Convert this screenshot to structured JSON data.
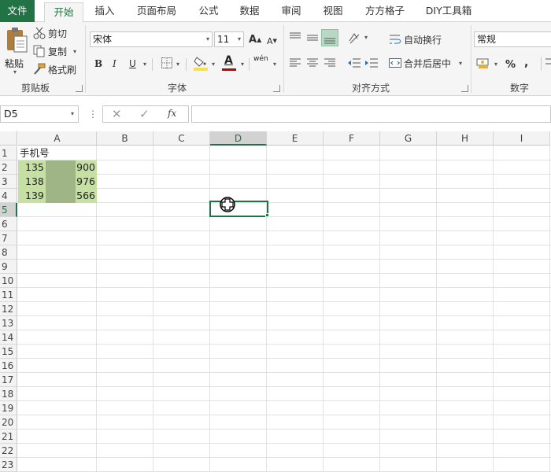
{
  "tabs": [
    "文件",
    "开始",
    "插入",
    "页面布局",
    "公式",
    "数据",
    "审阅",
    "视图",
    "方方格子",
    "DIY工具箱"
  ],
  "clipboard": {
    "paste": "粘贴",
    "cut": "剪切",
    "copy": "复制",
    "format_painter": "格式刷",
    "group": "剪贴板"
  },
  "font": {
    "name": "宋体",
    "size": "11",
    "bold": "B",
    "italic": "I",
    "underline": "U",
    "font_color_letter": "A",
    "phonetic": "wén",
    "grow": "A",
    "shrink": "A",
    "group": "字体"
  },
  "alignment": {
    "wrap": "自动换行",
    "merge": "合并后居中",
    "group": "对齐方式"
  },
  "number": {
    "format": "常规",
    "percent": "%",
    "comma": ",",
    "group": "数字"
  },
  "formula_bar": {
    "name_box": "D5",
    "fx": "fx",
    "formula": ""
  },
  "sheet": {
    "columns": [
      "A",
      "B",
      "C",
      "D",
      "E",
      "F",
      "G",
      "H",
      "I"
    ],
    "rows": [
      "1",
      "2",
      "3",
      "4",
      "5",
      "6",
      "7",
      "8",
      "9",
      "10",
      "11",
      "12",
      "13",
      "14",
      "15",
      "16",
      "17",
      "18",
      "19",
      "20",
      "21",
      "22",
      "23"
    ],
    "selected_cell": "D5",
    "cells": {
      "a1": "手机号",
      "a2_left": "135",
      "a2_right": "900",
      "a3_left": "138",
      "a3_right": "976",
      "a4_left": "139",
      "a4_right": "566"
    }
  },
  "colors": {
    "accent": "#217346",
    "highlight": "#c6e0a4",
    "masked": "#9fb586",
    "fill_bar": "#f9e04b",
    "font_bar": "#c00000"
  }
}
